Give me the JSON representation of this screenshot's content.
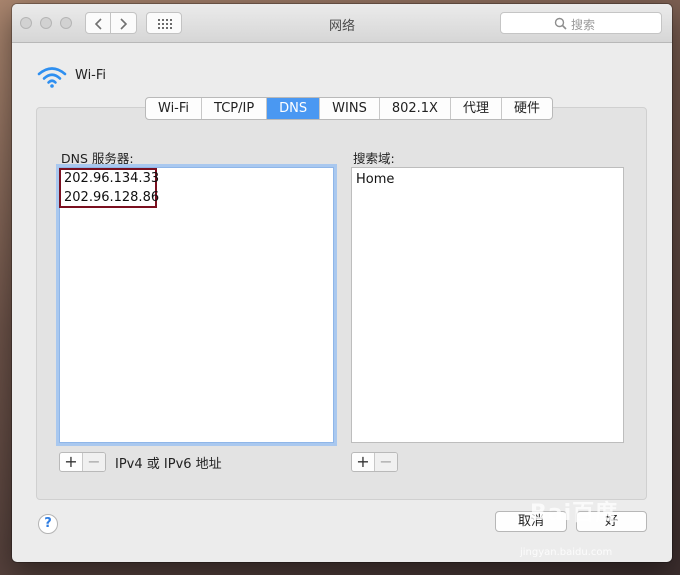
{
  "window": {
    "title": "网络"
  },
  "toolbar": {
    "search_placeholder": "搜索"
  },
  "connection": {
    "name": "Wi-Fi"
  },
  "tabs": [
    {
      "label": "Wi-Fi",
      "active": false
    },
    {
      "label": "TCP/IP",
      "active": false
    },
    {
      "label": "DNS",
      "active": true
    },
    {
      "label": "WINS",
      "active": false
    },
    {
      "label": "802.1X",
      "active": false
    },
    {
      "label": "代理",
      "active": false
    },
    {
      "label": "硬件",
      "active": false
    }
  ],
  "dns": {
    "label": "DNS 服务器:",
    "servers": [
      "202.96.134.33",
      "202.96.128.86"
    ],
    "hint": "IPv4 或 IPv6 地址"
  },
  "search_domains": {
    "label": "搜索域:",
    "items": [
      "Home"
    ]
  },
  "buttons": {
    "add": "+",
    "remove": "−",
    "help": "?",
    "cancel": "取消",
    "ok": "好"
  },
  "watermark": {
    "brand": "Bai百度",
    "url": "jingyan.baidu.com"
  },
  "colors": {
    "accent": "#4a98f2",
    "highlight_box": "#7a0f1f",
    "focus_ring": "#a9c8ef"
  },
  "icons": [
    "back-arrow-icon",
    "forward-arrow-icon",
    "grid-icon",
    "search-icon",
    "wifi-icon",
    "help-icon"
  ]
}
